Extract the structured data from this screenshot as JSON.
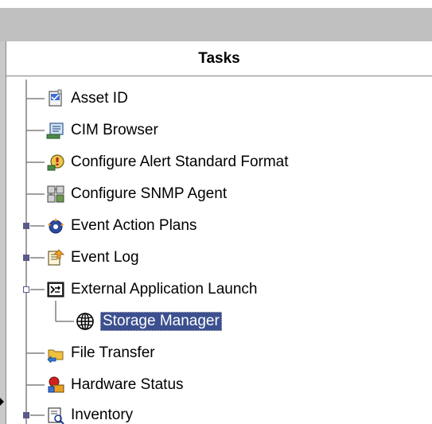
{
  "panel": {
    "title": "Tasks"
  },
  "tree": {
    "items": [
      {
        "label": "Asset ID",
        "icon": "asset-id-icon",
        "has_children": false,
        "expanded": false,
        "selected": false
      },
      {
        "label": "CIM Browser",
        "icon": "cim-browser-icon",
        "has_children": false,
        "expanded": false,
        "selected": false
      },
      {
        "label": "Configure Alert Standard Format",
        "icon": "alert-format-icon",
        "has_children": false,
        "expanded": false,
        "selected": false
      },
      {
        "label": "Configure SNMP Agent",
        "icon": "snmp-agent-icon",
        "has_children": false,
        "expanded": false,
        "selected": false
      },
      {
        "label": "Event Action Plans",
        "icon": "event-action-plans-icon",
        "has_children": true,
        "expanded": false,
        "selected": false
      },
      {
        "label": "Event Log",
        "icon": "event-log-icon",
        "has_children": true,
        "expanded": false,
        "selected": false
      },
      {
        "label": "External Application Launch",
        "icon": "external-app-launch-icon",
        "has_children": true,
        "expanded": true,
        "selected": false
      },
      {
        "label": "Storage Manager",
        "icon": "globe-icon",
        "has_children": false,
        "expanded": false,
        "selected": true
      },
      {
        "label": "File Transfer",
        "icon": "file-transfer-icon",
        "has_children": false,
        "expanded": false,
        "selected": false
      },
      {
        "label": "Hardware Status",
        "icon": "hardware-status-icon",
        "has_children": false,
        "expanded": false,
        "selected": false
      },
      {
        "label": "Inventory",
        "icon": "inventory-icon",
        "has_children": true,
        "expanded": false,
        "selected": false
      }
    ]
  },
  "colors": {
    "selection_bg": "#3c4f8f",
    "selection_text": "#ffffff",
    "panel_bg": "#ffffff",
    "header_bar": "#c0c0c0"
  }
}
